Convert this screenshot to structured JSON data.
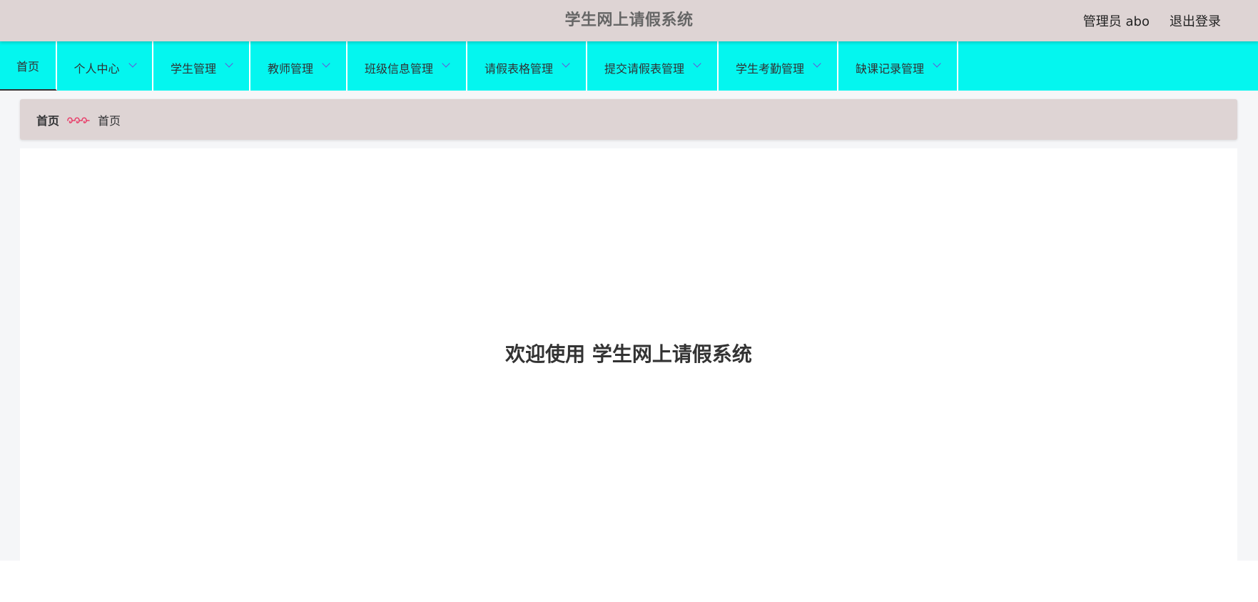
{
  "header": {
    "title": "学生网上请假系统",
    "user_label": "管理员 abo",
    "logout_label": "退出登录"
  },
  "nav": {
    "items": [
      {
        "label": "首页",
        "has_dropdown": false,
        "active": true
      },
      {
        "label": "个人中心",
        "has_dropdown": true
      },
      {
        "label": "学生管理",
        "has_dropdown": true
      },
      {
        "label": "教师管理",
        "has_dropdown": true
      },
      {
        "label": "班级信息管理",
        "has_dropdown": true
      },
      {
        "label": "请假表格管理",
        "has_dropdown": true
      },
      {
        "label": "提交请假表管理",
        "has_dropdown": true
      },
      {
        "label": "学生考勤管理",
        "has_dropdown": true
      },
      {
        "label": "缺课记录管理",
        "has_dropdown": true
      }
    ]
  },
  "breadcrumb": {
    "home": "首页",
    "separator_icon": "hearts-separator-icon",
    "current": "首页"
  },
  "main": {
    "welcome": "欢迎使用 学生网上请假系统"
  },
  "colors": {
    "header_bg": "#ded4d4",
    "nav_bg": "#04f6ef",
    "chevron": "#6b4fd8",
    "separator": "#e8406b",
    "page_bg": "#f5f6f8"
  }
}
